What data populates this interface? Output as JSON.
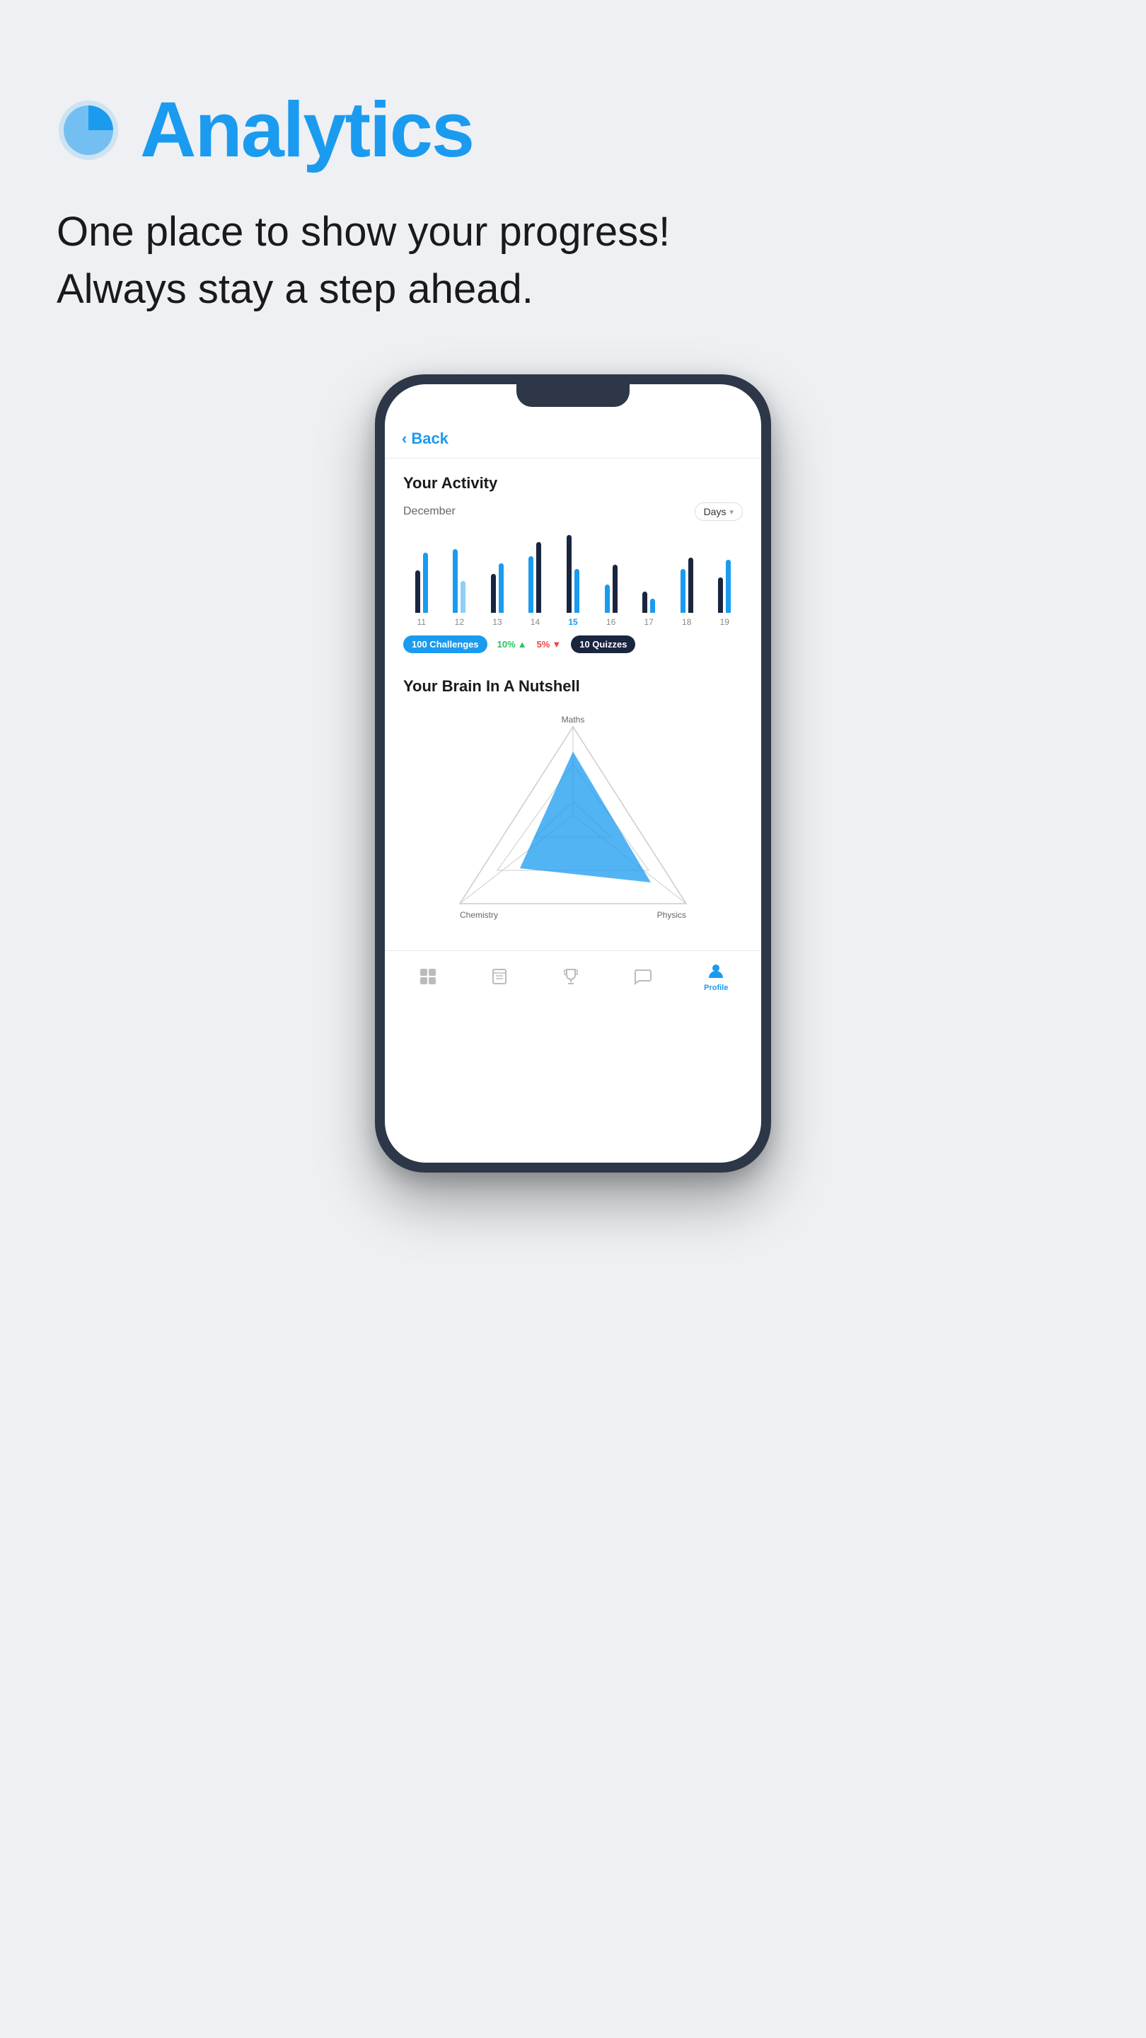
{
  "page": {
    "background_color": "#eef0f3",
    "title": "Analytics",
    "subtitle_line1": "One place to show your progress!",
    "subtitle_line2": "Always stay a step ahead."
  },
  "phone": {
    "back_label": "Back",
    "activity": {
      "section_title": "Your Activity",
      "month": "December",
      "period_selector": "Days",
      "bars": [
        {
          "day": "11",
          "heights": [
            60,
            85
          ],
          "colors": [
            "dark",
            "blue"
          ]
        },
        {
          "day": "12",
          "heights": [
            90,
            45
          ],
          "colors": [
            "blue",
            "light"
          ]
        },
        {
          "day": "13",
          "heights": [
            55,
            70
          ],
          "colors": [
            "dark",
            "blue"
          ]
        },
        {
          "day": "14",
          "heights": [
            80,
            100
          ],
          "colors": [
            "blue",
            "dark"
          ]
        },
        {
          "day": "15",
          "heights": [
            110,
            60
          ],
          "colors": [
            "dark",
            "blue"
          ],
          "highlight": true
        },
        {
          "day": "16",
          "heights": [
            40,
            70
          ],
          "colors": [
            "blue",
            "dark"
          ]
        },
        {
          "day": "17",
          "heights": [
            30,
            20
          ],
          "colors": [
            "dark",
            "blue"
          ]
        },
        {
          "day": "18",
          "heights": [
            60,
            80
          ],
          "colors": [
            "blue",
            "dark"
          ]
        },
        {
          "day": "19",
          "heights": [
            50,
            75
          ],
          "colors": [
            "dark",
            "blue"
          ]
        }
      ],
      "stats": {
        "challenges_badge": "100 Challenges",
        "percentage_green": "10%",
        "percentage_red": "5%",
        "quizzes_badge": "10 Quizzes"
      }
    },
    "brain": {
      "section_title": "Your Brain In A Nutshell",
      "radar_labels": {
        "top": "Maths",
        "bottom_left": "Chemistry",
        "bottom_right": "Physics"
      }
    },
    "bottom_nav": {
      "items": [
        {
          "icon": "grid-icon",
          "label": "",
          "active": false
        },
        {
          "icon": "book-icon",
          "label": "",
          "active": false
        },
        {
          "icon": "trophy-icon",
          "label": "",
          "active": false
        },
        {
          "icon": "chat-icon",
          "label": "",
          "active": false
        },
        {
          "icon": "profile-icon",
          "label": "Profile",
          "active": true
        }
      ]
    }
  }
}
